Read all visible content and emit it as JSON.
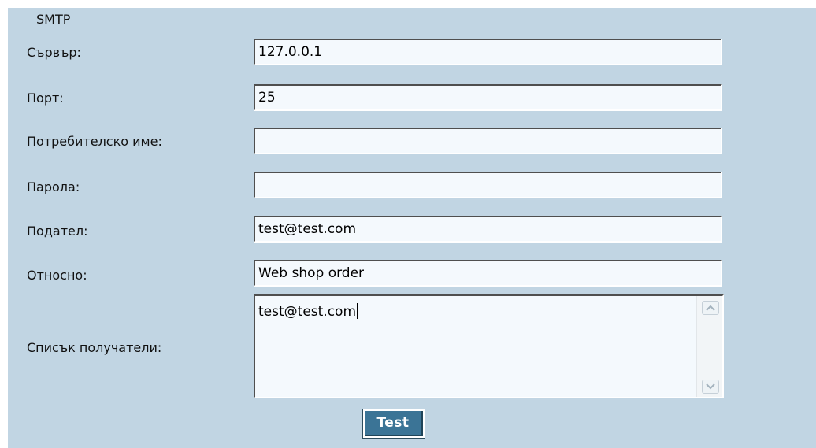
{
  "fieldset": {
    "legend": "SMTP"
  },
  "fields": {
    "server": {
      "label": "Сървър:",
      "value": "127.0.0.1"
    },
    "port": {
      "label": "Порт:",
      "value": "25"
    },
    "username": {
      "label": "Потребителско име:",
      "value": ""
    },
    "password": {
      "label": "Парола:",
      "value": ""
    },
    "sender": {
      "label": "Подател:",
      "value": "test@test.com"
    },
    "subject": {
      "label": "Относно:",
      "value": "Web shop order"
    },
    "recipients": {
      "label": "Списък получатели:",
      "value": "test@test.com"
    }
  },
  "actions": {
    "test_label": "Test"
  },
  "icons": {
    "scroll_up": "chevron-up-icon",
    "scroll_down": "chevron-down-icon"
  },
  "colors": {
    "panel_background": "#c1d5e3",
    "input_background": "#f4f9fd",
    "button_background": "#3b7496"
  }
}
